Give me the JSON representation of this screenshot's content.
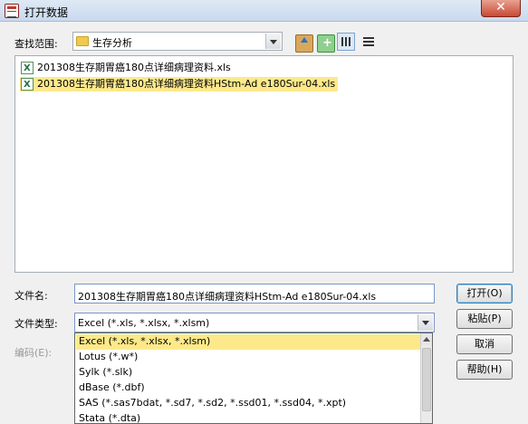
{
  "window": {
    "title": "打开数据",
    "close_label": "✕"
  },
  "lookin": {
    "label": "查找范围:",
    "folder": "生存分析"
  },
  "toolbar": {
    "up": "up-folder-icon",
    "new": "new-folder-icon",
    "list": "list-view-icon",
    "details": "details-view-icon"
  },
  "files": [
    {
      "name": "201308生存期胃癌180点详细病理资料.xls",
      "selected": false
    },
    {
      "name": "201308生存期胃癌180点详细病理资料HStm-Ad e180Sur-04.xls",
      "selected": true
    }
  ],
  "filename": {
    "label": "文件名:",
    "value": "201308生存期胃癌180点详细病理资料HStm-Ad e180Sur-04.xls"
  },
  "filetype": {
    "label": "文件类型:",
    "value": "Excel (*.xls, *.xlsx, *.xlsm)"
  },
  "encoding": {
    "label": "编码(E):"
  },
  "buttons": {
    "open": "打开(O)",
    "paste": "粘贴(P)",
    "cancel": "取消",
    "help": "帮助(H)"
  },
  "dropdown_options": [
    "Excel (*.xls, *.xlsx, *.xlsm)",
    "Lotus (*.w*)",
    "Sylk (*.slk)",
    "dBase (*.dbf)",
    "SAS (*.sas7bdat, *.sd7, *.sd2, *.ssd01, *.ssd04, *.xpt)",
    "Stata (*.dta)"
  ],
  "colors": {
    "selection": "#fde98a",
    "titlebar": "#c9d9ee"
  }
}
